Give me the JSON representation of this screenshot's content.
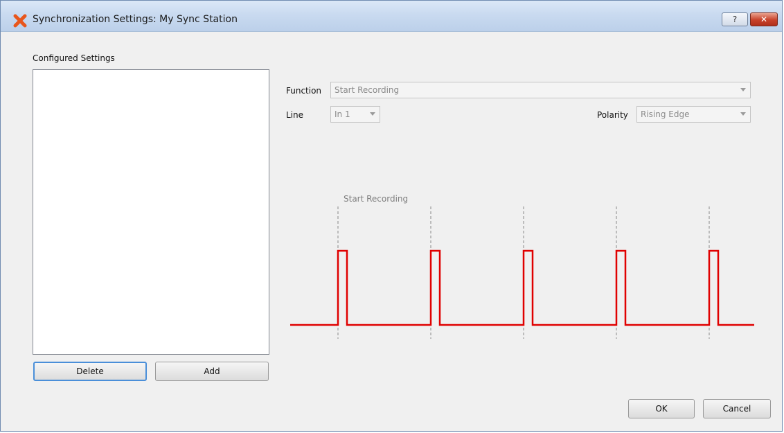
{
  "window": {
    "title": "Synchronization Settings: My Sync Station",
    "help_label": "?",
    "close_label": "✕"
  },
  "configured": {
    "label": "Configured Settings",
    "items": [],
    "delete_label": "Delete",
    "add_label": "Add"
  },
  "form": {
    "function_label": "Function",
    "function_value": "Start Recording",
    "line_label": "Line",
    "line_value": "In 1",
    "polarity_label": "Polarity",
    "polarity_value": "Rising Edge"
  },
  "diagram": {
    "annotation": "Start Recording",
    "pulse_count": 5,
    "signal_color": "#e00000",
    "marker_color": "#9a9a9a"
  },
  "footer": {
    "ok_label": "OK",
    "cancel_label": "Cancel"
  },
  "colors": {
    "accent_focus": "#4a8fd9",
    "close_button": "#c8412a",
    "app_icon": "#e8561c"
  }
}
